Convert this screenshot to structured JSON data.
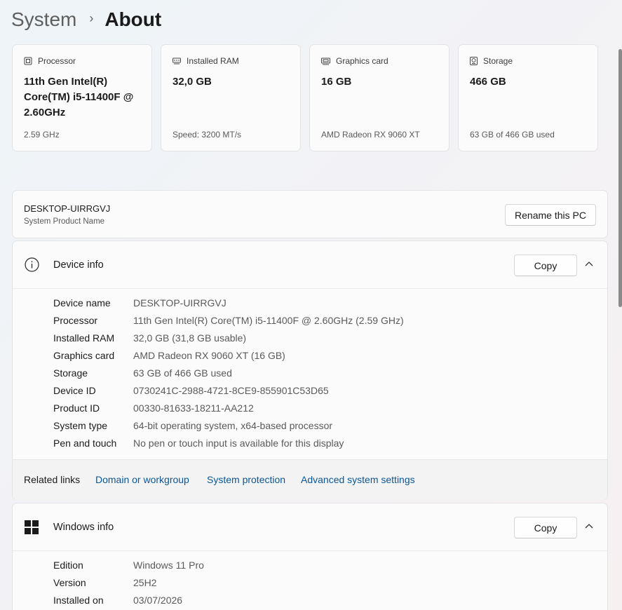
{
  "breadcrumb": {
    "parent": "System",
    "separator": "›",
    "current": "About"
  },
  "spec_cards": [
    {
      "title": "Processor",
      "value": "11th Gen Intel(R) Core(TM) i5-11400F @ 2.60GHz",
      "sub": "2.59 GHz",
      "icon": "processor-icon"
    },
    {
      "title": "Installed RAM",
      "value": "32,0 GB",
      "sub": "Speed: 3200 MT/s",
      "icon": "ram-icon"
    },
    {
      "title": "Graphics card",
      "value": "16 GB",
      "sub": "AMD Radeon RX 9060 XT",
      "icon": "graphics-card-icon"
    },
    {
      "title": "Storage",
      "value": "466 GB",
      "sub": "63 GB of 466 GB used",
      "icon": "storage-icon"
    }
  ],
  "pc": {
    "name": "DESKTOP-UIRRGVJ",
    "subtitle": "System Product Name",
    "rename_label": "Rename this PC"
  },
  "device_info": {
    "title": "Device info",
    "copy_label": "Copy",
    "rows": [
      {
        "label": "Device name",
        "value": "DESKTOP-UIRRGVJ"
      },
      {
        "label": "Processor",
        "value": "11th Gen Intel(R) Core(TM) i5-11400F @ 2.60GHz (2.59 GHz)"
      },
      {
        "label": "Installed RAM",
        "value": "32,0 GB (31,8 GB usable)"
      },
      {
        "label": "Graphics card",
        "value": "AMD Radeon RX 9060 XT (16 GB)"
      },
      {
        "label": "Storage",
        "value": "63 GB of 466 GB used"
      },
      {
        "label": "Device ID",
        "value": "0730241C-2988-4721-8CE9-855901C53D65"
      },
      {
        "label": "Product ID",
        "value": "00330-81633-18211-AA212"
      },
      {
        "label": "System type",
        "value": "64-bit operating system, x64-based processor"
      },
      {
        "label": "Pen and touch",
        "value": "No pen or touch input is available for this display"
      }
    ]
  },
  "related_links": {
    "title": "Related links",
    "links": [
      "Domain or workgroup",
      "System protection",
      "Advanced system settings"
    ]
  },
  "windows_info": {
    "title": "Windows info",
    "copy_label": "Copy",
    "rows": [
      {
        "label": "Edition",
        "value": "Windows 11 Pro"
      },
      {
        "label": "Version",
        "value": "25H2"
      },
      {
        "label": "Installed on",
        "value": "03/07/2026"
      }
    ]
  },
  "colors": {
    "link": "#0a5694",
    "card_bg": "#fbfbfb",
    "border": "#e3e3e3"
  }
}
